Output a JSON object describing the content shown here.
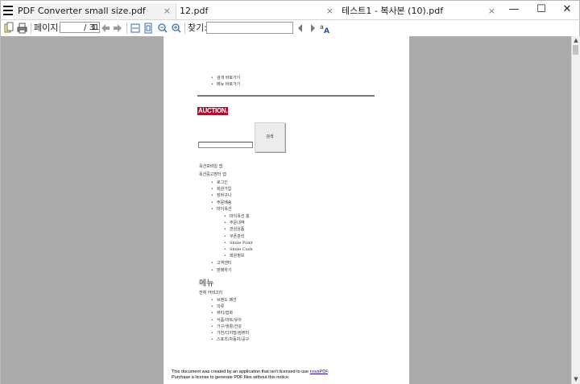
{
  "tabs": [
    {
      "label": "PDF Converter small size.pdf",
      "active": true
    },
    {
      "label": "12.pdf",
      "active": false
    },
    {
      "label": "테스트1 - 복사본 (10).pdf",
      "active": false
    }
  ],
  "tab_close": "×",
  "window": {
    "minimize": "—",
    "maximize": "☐",
    "close": "✕"
  },
  "toolbar": {
    "page_label": "페이지:",
    "page_current": "1",
    "page_total": "/ 31",
    "find_label": "찾기:",
    "find_value": ""
  },
  "document": {
    "top_links": [
      "검색 바로가기",
      "메뉴 바로가기"
    ],
    "logo": "AUCTION.",
    "search_button": "검색",
    "links": [
      "옥션모바일 앱",
      "옥션중고장터 앱"
    ],
    "nav_items": [
      "로그인",
      "회원가입",
      "장바구니",
      "주문배송",
      "마이옥션"
    ],
    "my_auction_items": [
      "마이옥션 홈",
      "주문내역",
      "관심상품",
      "쿠폰관리",
      "Smile Point",
      "Smile Cash",
      "회원정보"
    ],
    "nav_items_after": [
      "고객센터",
      "판매하기"
    ],
    "menu_heading": "메뉴",
    "all_category": "전체 카테고리",
    "categories": [
      "브랜드 패션",
      "의류",
      "뷰티/잡화",
      "식품/마트/유아",
      "가구/생활/건강",
      "가전/디지털/컴퓨터",
      "스포츠/자동차/공구"
    ],
    "footer_line1_prefix": "This document was created by an application that isn't licensed to use ",
    "footer_link": "novaPDF",
    "footer_line1_suffix": ".",
    "footer_line2": "Purchase a license to generate PDF files without this notice."
  },
  "colors": {
    "logo": "#b8072c",
    "panel_bg": "#ababab"
  }
}
